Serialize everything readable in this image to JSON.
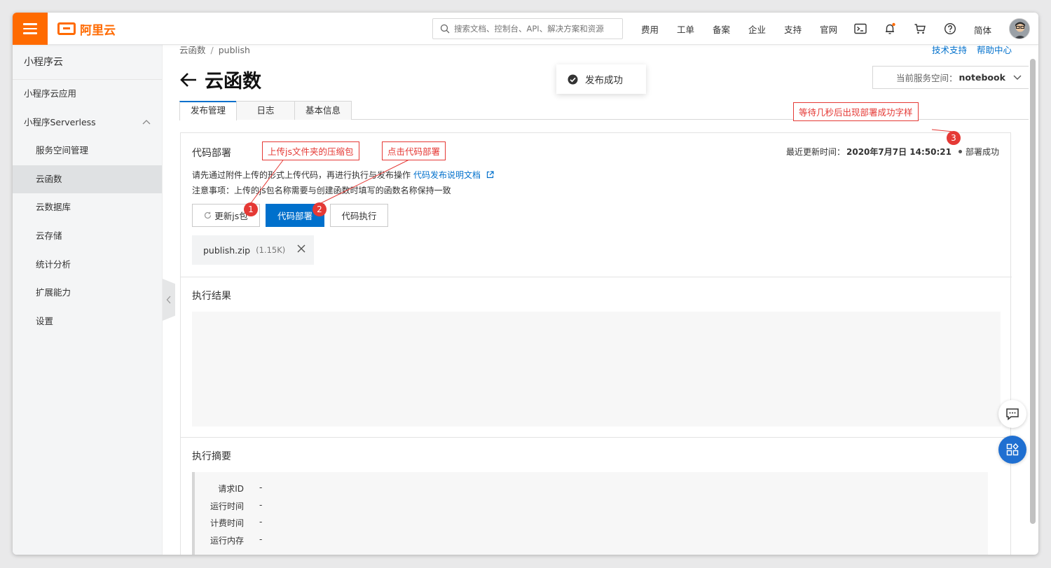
{
  "header": {
    "logo_text": "阿里云",
    "search_placeholder": "搜索文档、控制台、API、解决方案和资源",
    "nav": [
      "费用",
      "工单",
      "备案",
      "企业",
      "支持",
      "官网"
    ],
    "lang": "简体"
  },
  "sidebar": {
    "title": "小程序云",
    "items": [
      {
        "label": "小程序云应用"
      },
      {
        "label": "小程序Serverless"
      },
      {
        "label": "服务空间管理"
      },
      {
        "label": "云函数"
      },
      {
        "label": "云数据库"
      },
      {
        "label": "云存储"
      },
      {
        "label": "统计分析"
      },
      {
        "label": "扩展能力"
      },
      {
        "label": "设置"
      }
    ]
  },
  "breadcrumb": [
    "云函数",
    "publish"
  ],
  "toplinks": [
    "技术支持",
    "帮助中心"
  ],
  "page_title": "云函数",
  "toast": "发布成功",
  "space_select": {
    "label": "当前服务空间：",
    "value": "notebook"
  },
  "tabs": [
    "发布管理",
    "日志",
    "基本信息"
  ],
  "deploy": {
    "title": "代码部署",
    "desc1": "请先通过附件上传的形式上传代码，再进行执行与发布操作",
    "doc_link": "代码发布说明文档",
    "desc2": "注意事项：上传的js包名称需要与创建函数时填写的函数名称保持一致",
    "last_update_label": "最近更新时间：",
    "last_update_value": "2020年7月7日 14:50:21",
    "status": "部署成功",
    "buttons": {
      "update": "更新js包",
      "deploy": "代码部署",
      "run": "代码执行"
    },
    "file": {
      "name": "publish.zip",
      "size": "(1.15K)"
    }
  },
  "result": {
    "title": "执行结果"
  },
  "summary": {
    "title": "执行摘要",
    "rows": [
      {
        "k": "请求ID",
        "v": "-"
      },
      {
        "k": "运行时间",
        "v": "-"
      },
      {
        "k": "计费时间",
        "v": "-"
      },
      {
        "k": "运行内存",
        "v": "-"
      }
    ]
  },
  "annotations": [
    {
      "num": "1",
      "text": "上传js文件夹的压缩包"
    },
    {
      "num": "2",
      "text": "点击代码部署"
    },
    {
      "num": "3",
      "text": "等待几秒后出现部署成功字样"
    }
  ],
  "colors": {
    "brand": "#ff6a00",
    "primary": "#0070cc",
    "annotation": "#e53935"
  }
}
